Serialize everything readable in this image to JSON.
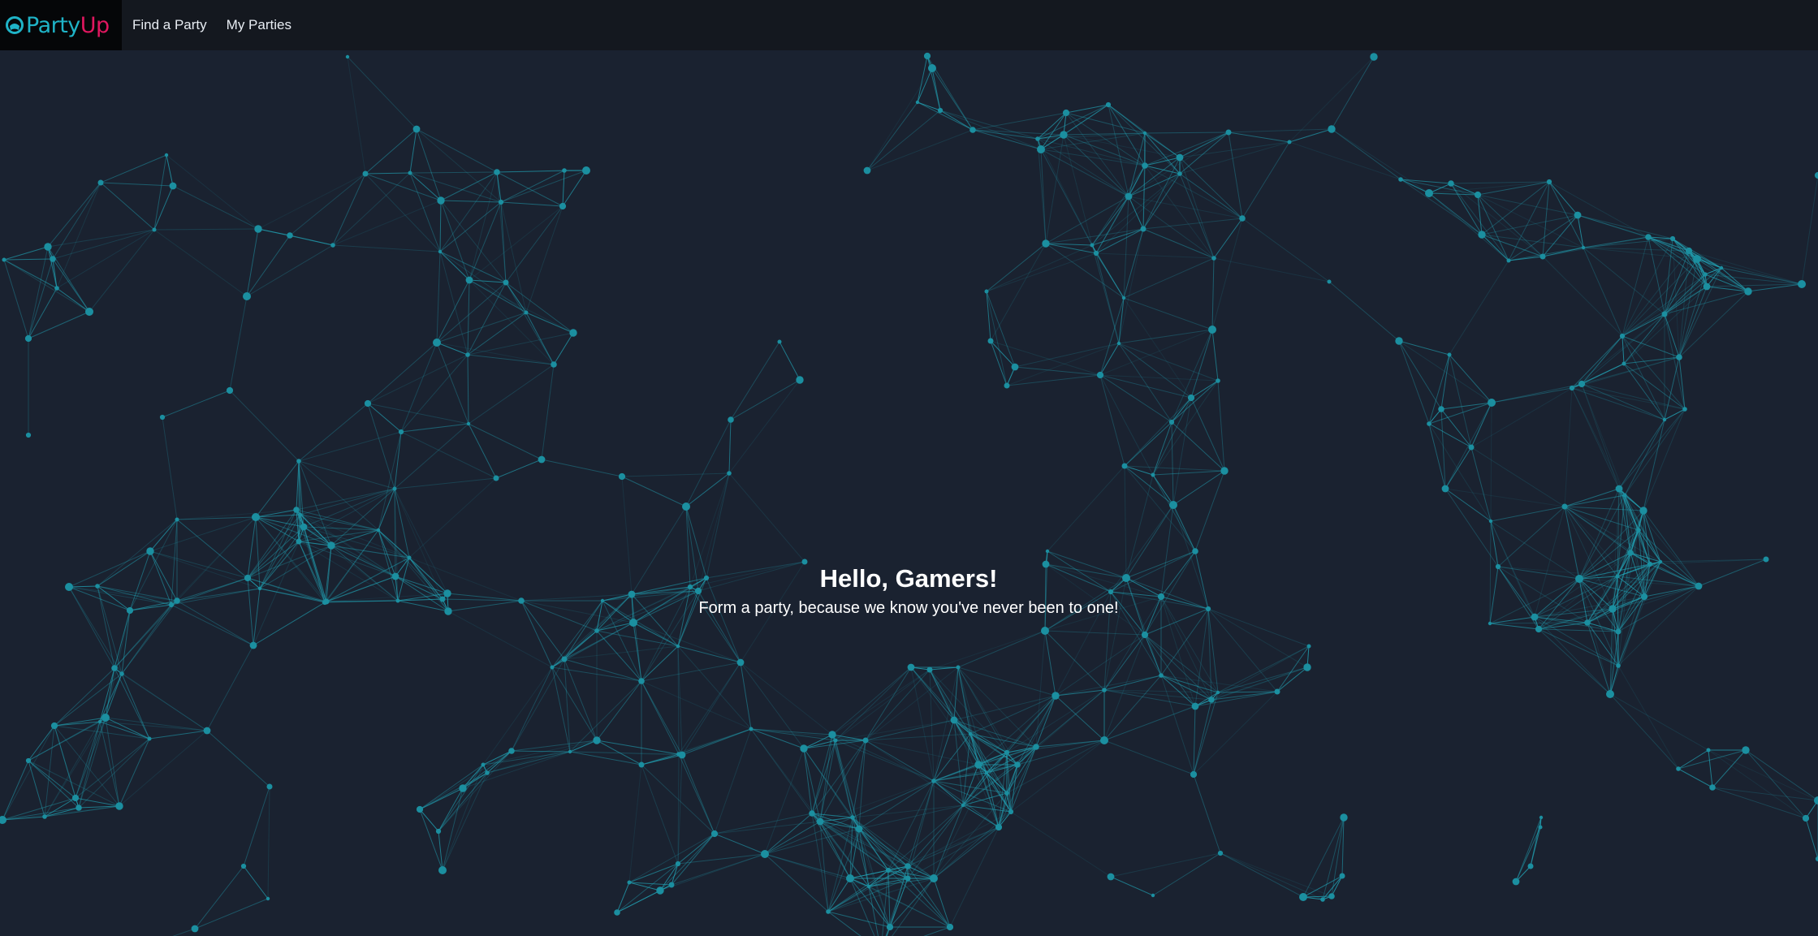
{
  "brand": {
    "name_part1": "Party",
    "name_part2": "Up",
    "icon": "gamepad-ring-icon",
    "colors": {
      "primary": "#1fb3c7",
      "accent": "#e0175f",
      "background": "#050608"
    }
  },
  "nav": {
    "links": [
      {
        "label": "Find a Party"
      },
      {
        "label": "My Parties"
      }
    ]
  },
  "hero": {
    "title": "Hello, Gamers!",
    "subtitle": "Form a party, because we know you've never been to one!"
  },
  "theme": {
    "page_background": "#1a2230",
    "navbar_background": "#14181f",
    "network_line_color": "#22a6b8",
    "network_node_color": "#1b8fa0"
  }
}
